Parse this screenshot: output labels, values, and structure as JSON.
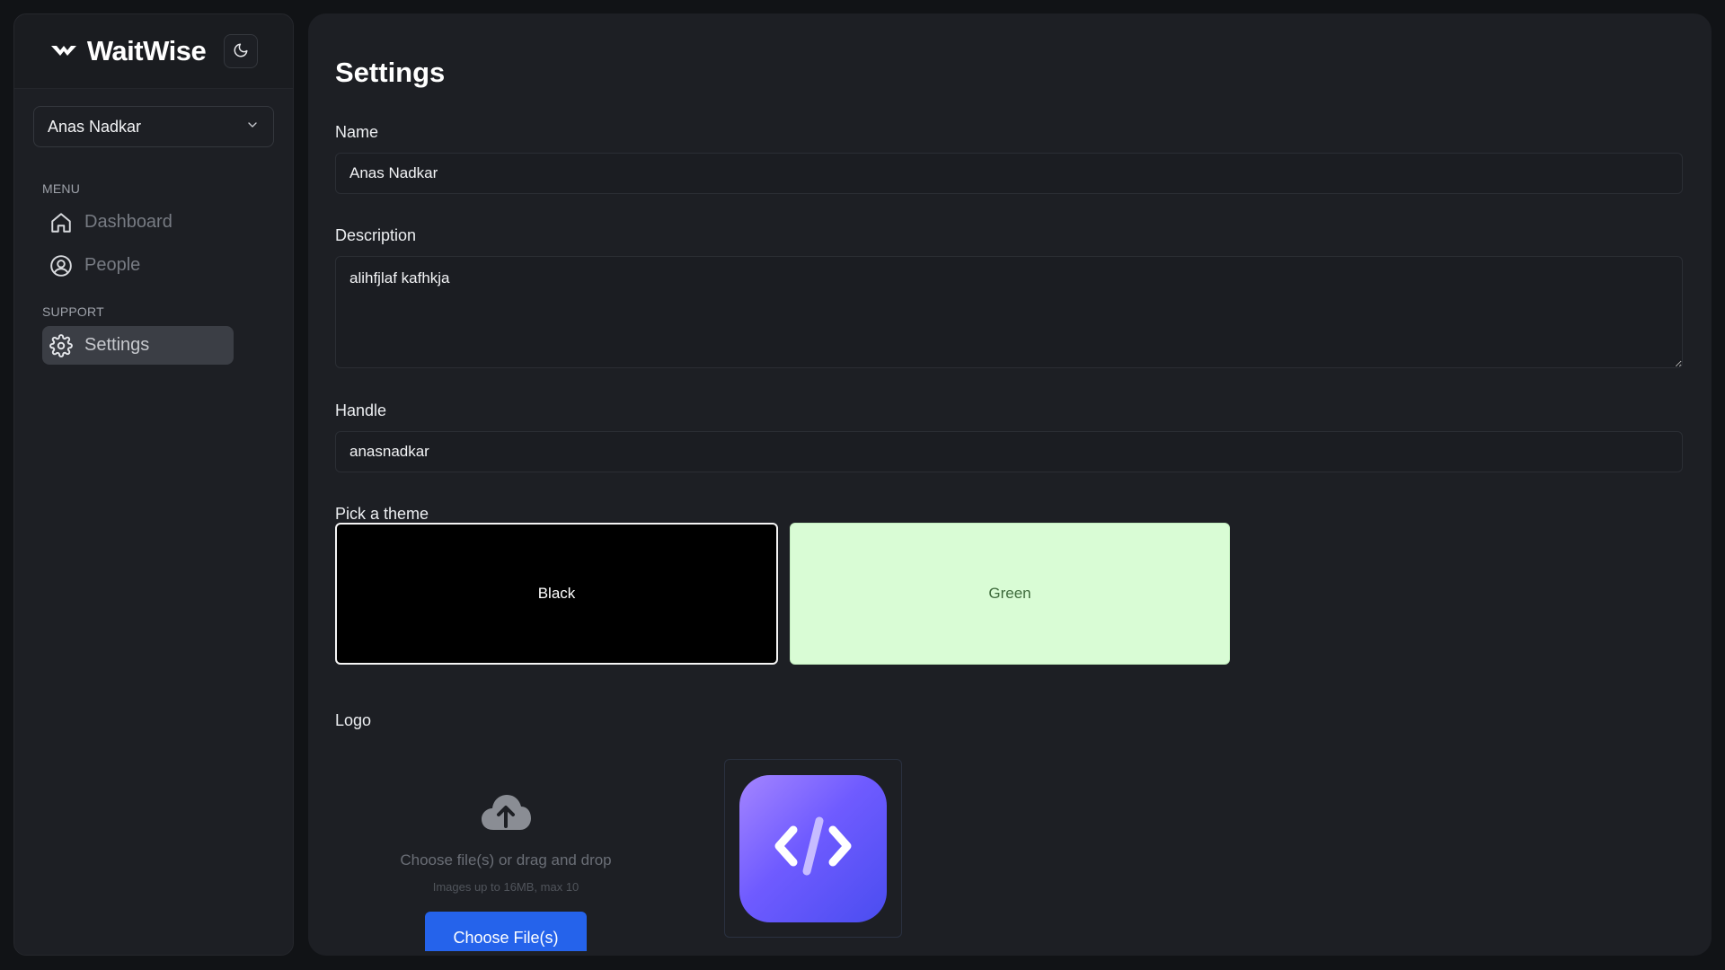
{
  "app": {
    "name": "WaitWise",
    "theme_toggle_icon": "moon-icon",
    "colors": {
      "accent": "#2563eb",
      "background": "#111316",
      "panel": "#1d1f24"
    }
  },
  "user_select": {
    "value": "Anas Nadkar",
    "icon": "chevron-down-icon"
  },
  "sidebar": {
    "sections": [
      {
        "heading": "MENU",
        "items": [
          {
            "label": "Dashboard",
            "icon": "home-icon",
            "active": false
          },
          {
            "label": "People",
            "icon": "user-circle-icon",
            "active": false
          }
        ]
      },
      {
        "heading": "SUPPORT",
        "items": [
          {
            "label": "Settings",
            "icon": "gear-icon",
            "active": true
          }
        ]
      }
    ]
  },
  "settings": {
    "title": "Settings",
    "name_label": "Name",
    "name_value": "Anas Nadkar",
    "description_label": "Description",
    "description_value": "alihfjlaf kafhkja",
    "handle_label": "Handle",
    "handle_value": "anasnadkar",
    "theme_label": "Pick a theme",
    "themes": [
      {
        "label": "Black",
        "color": "#000000",
        "selected": true
      },
      {
        "label": "Green",
        "color": "#d9fcd5",
        "selected": false
      }
    ],
    "logo_label": "Logo",
    "upload": {
      "title": "Choose file(s) or drag and drop",
      "subtitle": "Images up to 16MB, max 10",
      "button_label": "Choose File(s)",
      "icon": "cloud-upload-icon"
    },
    "logo_preview_icon": "code-icon"
  }
}
